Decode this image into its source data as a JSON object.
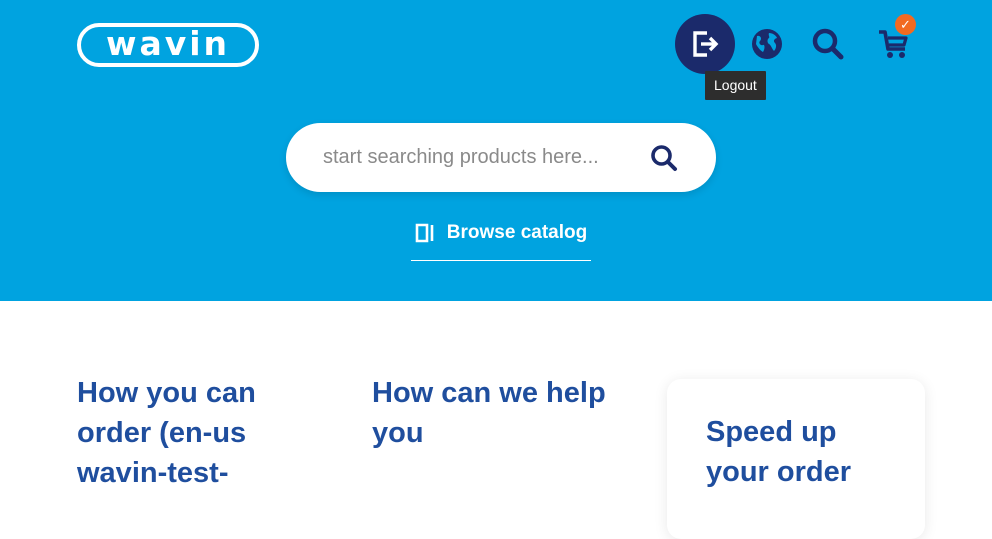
{
  "header": {
    "logo_text": "wavin",
    "logout_tooltip": "Logout",
    "cart_badge": "✓",
    "icons": [
      "logout-icon",
      "globe-icon",
      "search-icon",
      "cart-icon"
    ]
  },
  "search": {
    "placeholder": "start searching products here..."
  },
  "browse": {
    "label": "Browse catalog"
  },
  "content": {
    "col1_heading": "How you can order (en-us wavin-test-",
    "col2_heading": "How can we help you",
    "card_heading": "Speed up your order"
  },
  "colors": {
    "hero_bg": "#00a3e0",
    "dark_navy": "#1b2a6b",
    "heading_blue": "#1f4e9e",
    "badge_orange": "#f26a21"
  }
}
